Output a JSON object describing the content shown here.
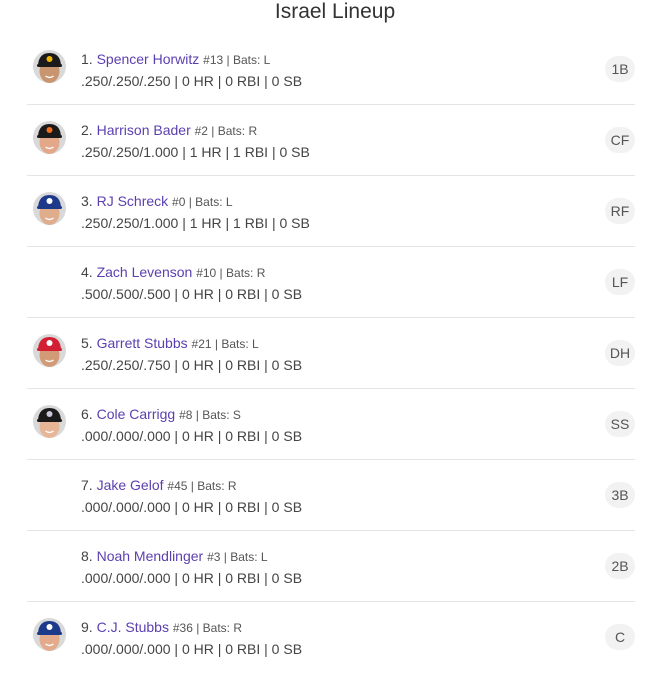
{
  "title": "Israel Lineup",
  "players": [
    {
      "order": "1.",
      "name": "Spencer Horwitz",
      "meta": "#13 | Bats: L",
      "stats": ".250/.250/.250 | 0 HR | 0 RBI | 0 SB",
      "position": "1B",
      "cap": "pirates",
      "cap_color": "#1a1a1a",
      "cap_logo": "#f2b600",
      "skin": "#c9956f"
    },
    {
      "order": "2.",
      "name": "Harrison Bader",
      "meta": "#2 | Bats: R",
      "stats": ".250/.250/1.000 | 1 HR | 1 RBI | 0 SB",
      "position": "CF",
      "cap": "giants",
      "cap_color": "#1a1a1a",
      "cap_logo": "#f46f20",
      "skin": "#e3a789"
    },
    {
      "order": "3.",
      "name": "RJ Schreck",
      "meta": "#0 | Bats: L",
      "stats": ".250/.250/1.000 | 1 HR | 1 RBI | 0 SB",
      "position": "RF",
      "cap": "blue-jays",
      "cap_color": "#1d3a8a",
      "cap_logo": "#ffffff",
      "skin": "#e0ad8c"
    },
    {
      "order": "4.",
      "name": "Zach Levenson",
      "meta": "#10 | Bats: R",
      "stats": ".500/.500/.500 | 0 HR | 0 RBI | 0 SB",
      "position": "LF",
      "cap": "",
      "cap_color": "",
      "cap_logo": "",
      "skin": ""
    },
    {
      "order": "5.",
      "name": "Garrett Stubbs",
      "meta": "#21 | Bats: L",
      "stats": ".250/.250/.750 | 0 HR | 0 RBI | 0 SB",
      "position": "DH",
      "cap": "phillies",
      "cap_color": "#d21f33",
      "cap_logo": "#ffffff",
      "skin": "#d29a77"
    },
    {
      "order": "6.",
      "name": "Cole Carrigg",
      "meta": "#8 | Bats: S",
      "stats": ".000/.000/.000 | 0 HR | 0 RBI | 0 SB",
      "position": "SS",
      "cap": "rockies",
      "cap_color": "#1a1a1a",
      "cap_logo": "#c8c8d8",
      "skin": "#e8b597"
    },
    {
      "order": "7.",
      "name": "Jake Gelof",
      "meta": "#45 | Bats: R",
      "stats": ".000/.000/.000 | 0 HR | 0 RBI | 0 SB",
      "position": "3B",
      "cap": "",
      "cap_color": "",
      "cap_logo": "",
      "skin": ""
    },
    {
      "order": "8.",
      "name": "Noah Mendlinger",
      "meta": "#3 | Bats: L",
      "stats": ".000/.000/.000 | 0 HR | 0 RBI | 0 SB",
      "position": "2B",
      "cap": "",
      "cap_color": "",
      "cap_logo": "",
      "skin": ""
    },
    {
      "order": "9.",
      "name": "C.J. Stubbs",
      "meta": "#36 | Bats: R",
      "stats": ".000/.000/.000 | 0 HR | 0 RBI | 0 SB",
      "position": "C",
      "cap": "blue-jays",
      "cap_color": "#1d3a8a",
      "cap_logo": "#ffffff",
      "skin": "#e3ab8c"
    }
  ]
}
